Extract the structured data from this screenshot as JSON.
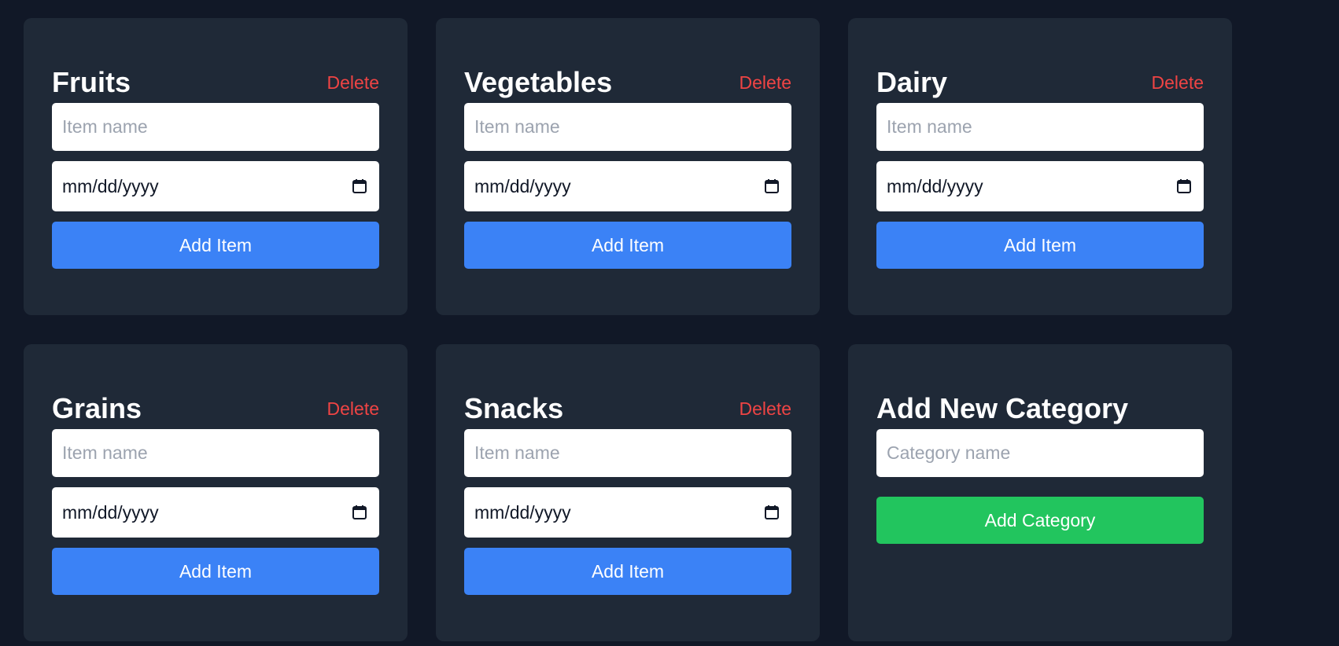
{
  "colors": {
    "background": "#111827",
    "card": "#1f2937",
    "delete": "#ef4444",
    "add_item_button": "#3b82f6",
    "add_category_button": "#22c55e"
  },
  "categories": [
    {
      "title": "Fruits",
      "delete_label": "Delete",
      "item_placeholder": "Item name",
      "date_placeholder": "mm/dd/yyyy",
      "add_label": "Add Item"
    },
    {
      "title": "Vegetables",
      "delete_label": "Delete",
      "item_placeholder": "Item name",
      "date_placeholder": "mm/dd/yyyy",
      "add_label": "Add Item"
    },
    {
      "title": "Dairy",
      "delete_label": "Delete",
      "item_placeholder": "Item name",
      "date_placeholder": "mm/dd/yyyy",
      "add_label": "Add Item"
    },
    {
      "title": "Grains",
      "delete_label": "Delete",
      "item_placeholder": "Item name",
      "date_placeholder": "mm/dd/yyyy",
      "add_label": "Add Item"
    },
    {
      "title": "Snacks",
      "delete_label": "Delete",
      "item_placeholder": "Item name",
      "date_placeholder": "mm/dd/yyyy",
      "add_label": "Add Item"
    }
  ],
  "new_category": {
    "title": "Add New Category",
    "placeholder": "Category name",
    "button_label": "Add Category"
  },
  "icons": {
    "date_picker": "calendar-icon"
  }
}
